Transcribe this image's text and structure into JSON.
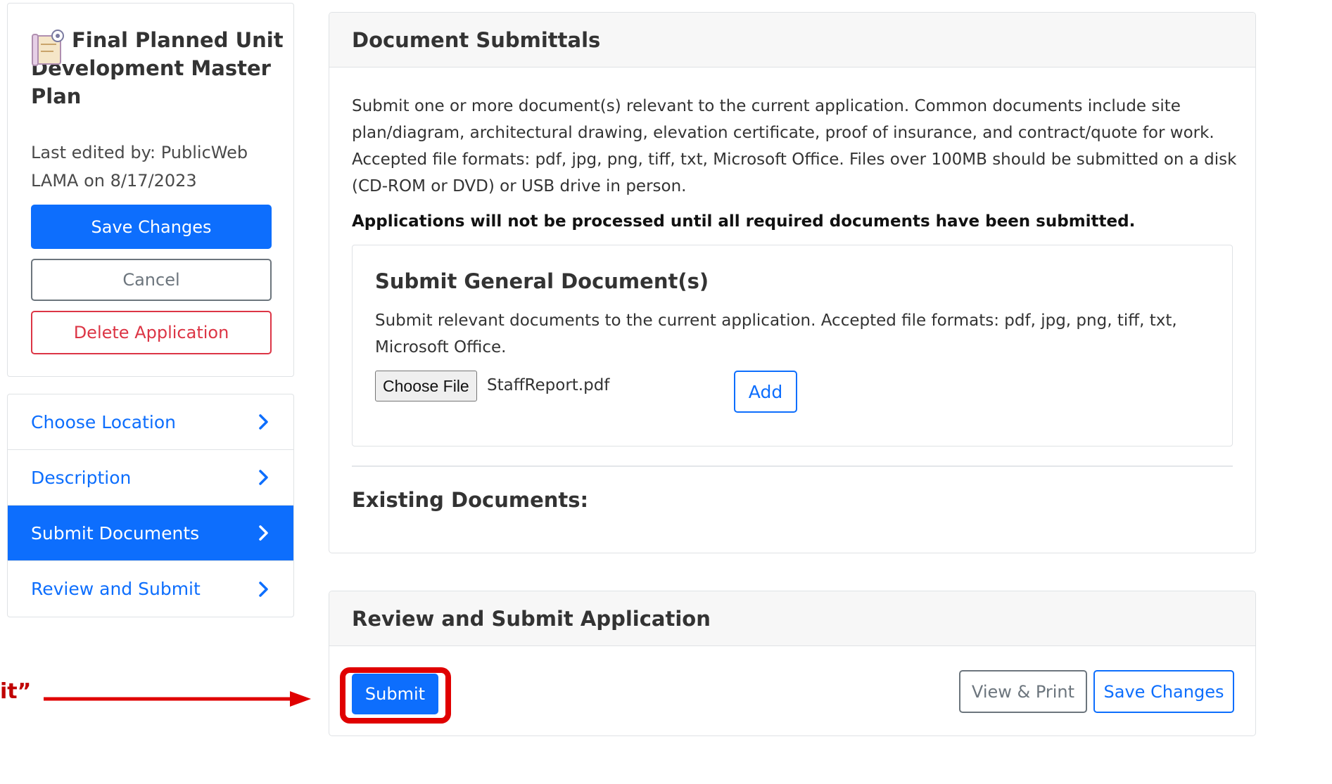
{
  "sidebar": {
    "app_title": "Final Planned Unit Development Master Plan",
    "last_edited": "Last edited by: PublicWeb LAMA on 8/17/2023",
    "save_label": "Save Changes",
    "cancel_label": "Cancel",
    "delete_label": "Delete Application"
  },
  "nav": {
    "items": [
      {
        "label": "Choose Location",
        "active": false
      },
      {
        "label": "Description",
        "active": false
      },
      {
        "label": "Submit Documents",
        "active": true
      },
      {
        "label": "Review and Submit",
        "active": false
      }
    ]
  },
  "documents": {
    "header": "Document Submittals",
    "intro": "Submit one or more document(s) relevant to the current application. Common documents include site plan/diagram, architectural drawing, elevation certificate, proof of insurance, and contract/quote for work. Accepted file formats: pdf, jpg, png, tiff, txt, Microsoft Office. Files over 100MB should be submitted on a disk (CD-ROM or DVD) or USB drive in person.",
    "warning": "Applications will not be processed until all required documents have been submitted.",
    "general": {
      "title": "Submit General Document(s)",
      "description": "Submit relevant documents to the current application. Accepted file formats: pdf, jpg, png, tiff, txt, Microsoft Office.",
      "choose_file_label": "Choose File",
      "file_name": "StaffReport.pdf",
      "add_label": "Add"
    },
    "existing_label": "Existing Documents:"
  },
  "review": {
    "header": "Review and Submit Application",
    "submit_label": "Submit",
    "view_print_label": "View & Print",
    "save_label": "Save Changes"
  },
  "annotation": {
    "label": "it”"
  },
  "colors": {
    "primary": "#0d6efd",
    "danger": "#dc3545",
    "secondary": "#6c757d",
    "annotation": "#e00000"
  }
}
